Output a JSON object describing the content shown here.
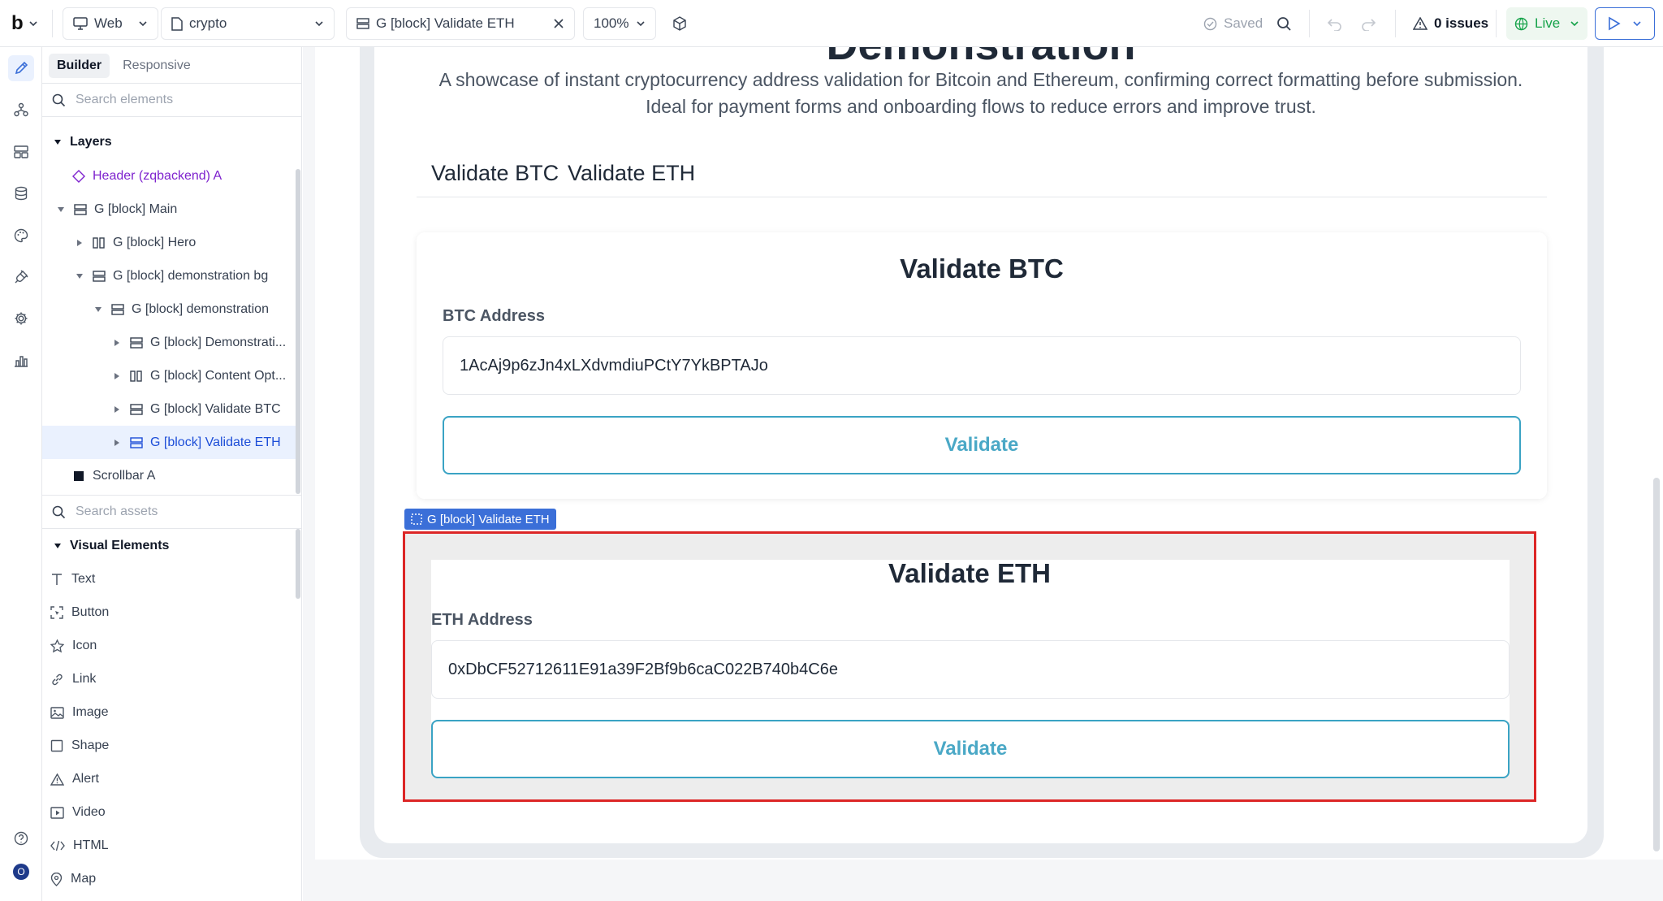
{
  "topbar": {
    "platform": "Web",
    "project": "crypto",
    "open_tab": "G [block] Validate ETH",
    "zoom": "100%",
    "saved": "Saved",
    "issues": "0 issues",
    "live": "Live"
  },
  "panel": {
    "tab_builder": "Builder",
    "tab_responsive": "Responsive",
    "search_elements_placeholder": "Search elements",
    "layers_heading": "Layers",
    "layers": [
      {
        "label": "Header (zqbackend) A"
      },
      {
        "label": "G [block] Main"
      },
      {
        "label": "G [block] Hero"
      },
      {
        "label": "G [block] demonstration bg"
      },
      {
        "label": "G [block] demonstration"
      },
      {
        "label": "G [block] Demonstrati..."
      },
      {
        "label": "G [block] Content Opt..."
      },
      {
        "label": "G [block] Validate BTC"
      },
      {
        "label": "G [block] Validate ETH"
      },
      {
        "label": "Scrollbar A"
      }
    ],
    "search_assets_placeholder": "Search assets",
    "visual_elements_heading": "Visual Elements",
    "assets": [
      {
        "label": "Text"
      },
      {
        "label": "Button"
      },
      {
        "label": "Icon"
      },
      {
        "label": "Link"
      },
      {
        "label": "Image"
      },
      {
        "label": "Shape"
      },
      {
        "label": "Alert"
      },
      {
        "label": "Video"
      },
      {
        "label": "HTML"
      },
      {
        "label": "Map"
      }
    ]
  },
  "canvas": {
    "hero_title": "Demonstration",
    "hero_description_line1": "A showcase of instant cryptocurrency address validation for Bitcoin and Ethereum, confirming correct formatting before submission.",
    "hero_description_line2": "Ideal for payment forms and onboarding flows to reduce errors and improve trust.",
    "tab_btc": "Validate BTC",
    "tab_eth": "Validate ETH",
    "btc_card": {
      "title": "Validate BTC",
      "label": "BTC Address",
      "value": "1AcAj9p6zJn4xLXdvmdiuPCtY7YkBPTAJo",
      "button": "Validate"
    },
    "selection_badge": "G [block] Validate ETH",
    "eth_card": {
      "title": "Validate ETH",
      "label": "ETH Address",
      "value": "0xDbCF52712611E91a39F2Bf9b6caC022B740b4C6e",
      "button": "Validate"
    }
  },
  "rail": {
    "avatar_initial": "O"
  },
  "colors": {
    "accent": "#3b6fd8",
    "selection": "#dc2626",
    "validate_button": "#3aa3c4",
    "live_green": "#16a34a"
  }
}
